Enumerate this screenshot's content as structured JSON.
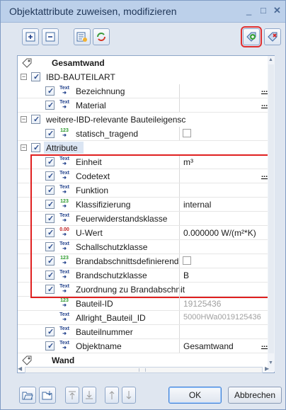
{
  "window": {
    "title": "Objektattribute zuweisen, modifizieren",
    "controls": [
      "_",
      "□",
      "✕"
    ]
  },
  "tree": {
    "groups": [
      {
        "label": "Gesamtwand"
      },
      {
        "label": "IBD-BAUTEILART"
      },
      {
        "label": "weitere-IBD-relevante Bauteileigensc"
      },
      {
        "label": "Attribute"
      },
      {
        "label": "Wand"
      }
    ],
    "rows": [
      {
        "type": "Text",
        "label": "Bezeichnung",
        "value": "",
        "dots": "..."
      },
      {
        "type": "Text",
        "label": "Material",
        "value": "",
        "dots": "..."
      },
      {
        "type": "123",
        "label": "statisch_tragend",
        "value": ""
      },
      {
        "type": "Text",
        "label": "Einheit",
        "value": "m³"
      },
      {
        "type": "Text",
        "label": "Codetext",
        "value": "",
        "dots": "..."
      },
      {
        "type": "Text",
        "label": "Funktion",
        "value": ""
      },
      {
        "type": "123",
        "label": "Klassifizierung",
        "value": "internal"
      },
      {
        "type": "Text",
        "label": "Feuerwiderstandsklasse",
        "value": ""
      },
      {
        "type": "0.00",
        "label": "U-Wert",
        "value": "0.000000 W/(m²*K)"
      },
      {
        "type": "Text",
        "label": "Schallschutzklasse",
        "value": ""
      },
      {
        "type": "123",
        "label": "Brandabschnittsdefinierend",
        "value": ""
      },
      {
        "type": "Text",
        "label": "Brandschutzklasse",
        "value": "B"
      },
      {
        "type": "Text",
        "label": "Zuordnung zu Brandabschnit",
        "value": ""
      },
      {
        "type": "123",
        "label": "Bauteil-ID",
        "value": "19125436"
      },
      {
        "type": "Text",
        "label": "Allright_Bauteil_ID",
        "value": "5000HWa0019125436"
      },
      {
        "type": "Text",
        "label": "Bauteilnummer",
        "value": ""
      },
      {
        "type": "Text",
        "label": "Objektname",
        "value": "Gesamtwand",
        "dots": "..."
      }
    ]
  },
  "icons": {
    "text_type": "Text",
    "num_type": "123",
    "float_type": "0.00",
    "expander_minus": "−",
    "checkmark": "✓",
    "scroll_up": "▲",
    "scroll_down": "▼",
    "scroll_left": "◀",
    "scroll_right": "▶"
  },
  "footer": {
    "ok_label": "OK",
    "cancel_label": "Abbrechen"
  },
  "colors": {
    "highlight": "#e02020",
    "selected_row": "#dbe5f3",
    "text_icon": "#1f3f8a",
    "num_icon": "#2a9a2a",
    "float_icon": "#c02020"
  }
}
